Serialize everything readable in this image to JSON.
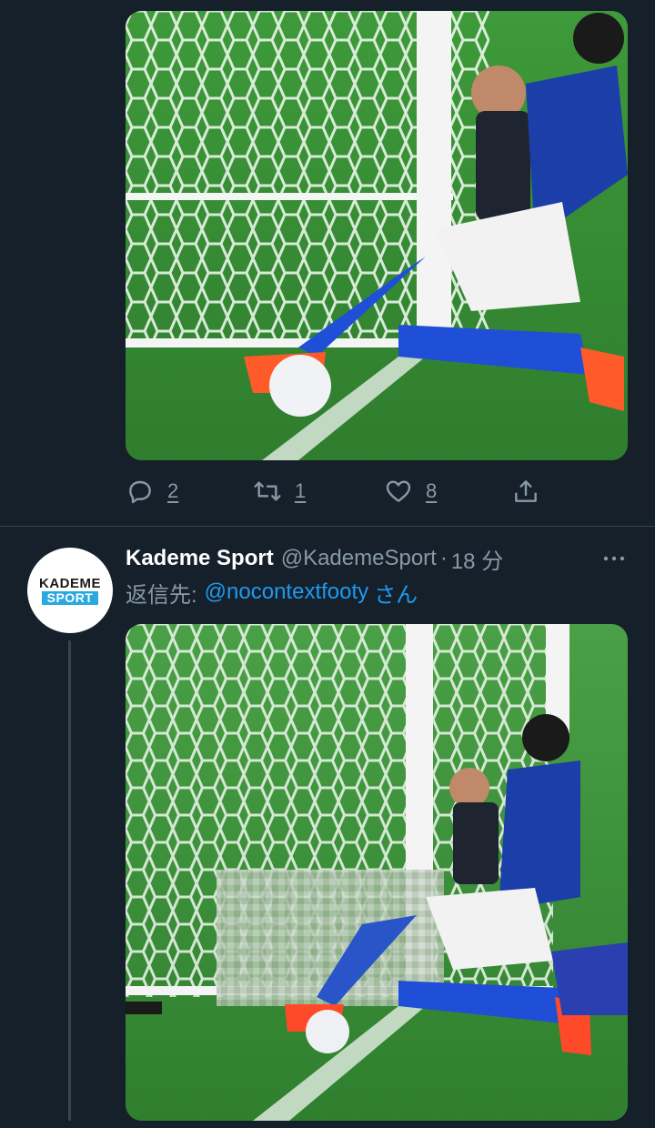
{
  "tweet1": {
    "actions": {
      "replies": "2",
      "retweets": "1",
      "likes": "8"
    },
    "icons": [
      "reply-icon",
      "retweet-icon",
      "like-icon",
      "share-icon"
    ]
  },
  "tweet2": {
    "avatar": {
      "logo_top": "KADEME",
      "logo_bottom": "SPORT",
      "logo_accent": "#2aa8e0"
    },
    "display_name": "Kademe Sport",
    "handle": "@KademeSport",
    "separator": "·",
    "time": "18 分",
    "reply_prefix": "返信先:",
    "reply_handle": "@nocontextfooty",
    "reply_suffix": "さん"
  },
  "colors": {
    "background": "#15202b",
    "muted": "#8899a6",
    "link": "#1d9bf0",
    "divider": "#38444d"
  }
}
